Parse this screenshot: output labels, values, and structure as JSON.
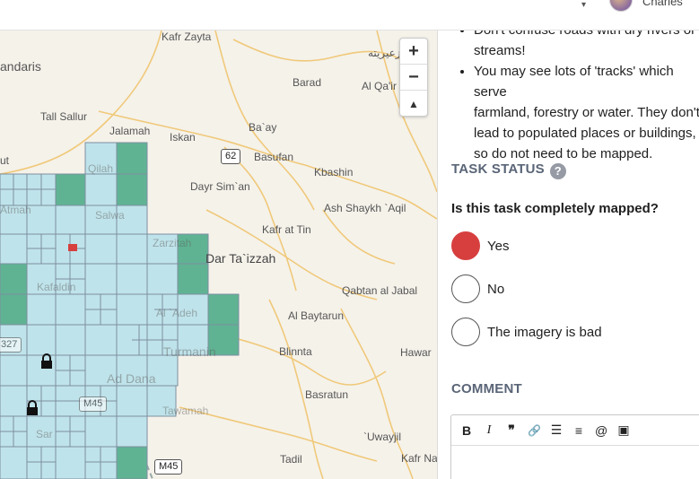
{
  "header": {
    "user_name": "Charles",
    "chevron": "▾"
  },
  "map": {
    "labels": [
      "Kafr Zayta",
      "andaris",
      "زعيريته",
      "Barad",
      "Al Qa'ir",
      "Tall Sallur",
      "Jalamah",
      "Iskan",
      "Ba`ay",
      "Basufan",
      "Dayr Sim`an",
      "Kbashin",
      "Ash Shaykh `Aqil",
      "Kafr at Tin",
      "Qabtan al Jabal",
      "Al Baytarun",
      "Blinnta",
      "Hawar",
      "Basratun",
      "`Uwayjil",
      "Tadil",
      "Kafr Na",
      "ut"
    ],
    "big_label": "Dar Ta`izzah",
    "faint_labels": [
      "Qilah",
      "Atmah",
      "Salwa",
      "Zarzitah",
      "Kafaldin",
      "Al `Adeh",
      "Turmanin",
      "Ad Dana",
      "Tawamah",
      "Sar"
    ],
    "shields": [
      "62",
      "M45",
      "M45",
      "327"
    ],
    "zoom_in": "+",
    "zoom_out": "−",
    "north": "▲"
  },
  "panel": {
    "bullets": [
      "Don't confuse roads with dry rivers or\nstreams!",
      "You may see lots of 'tracks' which serve\nfarmland, forestry or water. They don't\nlead to populated places or buildings,\nso do not need to be mapped."
    ],
    "task_status": "TASK STATUS",
    "help": "?",
    "question": "Is this task completely mapped?",
    "options": [
      "Yes",
      "No",
      "The imagery is bad"
    ],
    "selected": 0,
    "comment": "COMMENT",
    "toolbar": [
      "B",
      "I",
      "❞",
      "🔗",
      "☰",
      "≡",
      "@",
      "▣"
    ]
  },
  "colors": {
    "selected": "#d73f3f",
    "grid_fill": "#bfe3ea",
    "grid_done": "#5fb393",
    "grid_stroke": "#7e8fa0"
  }
}
